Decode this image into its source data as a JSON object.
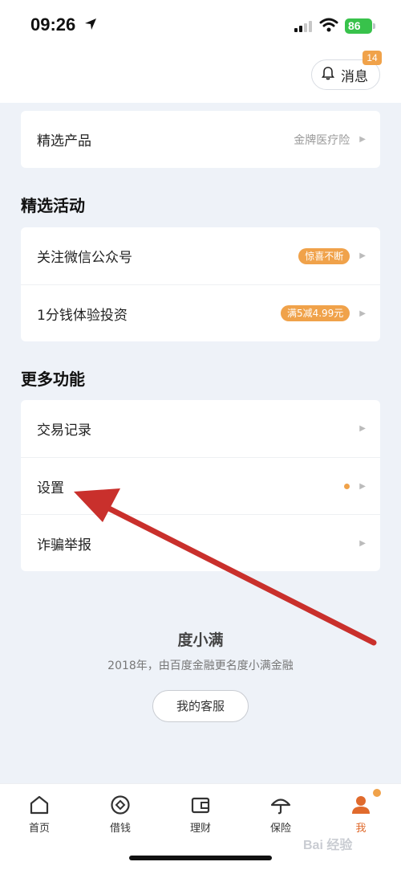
{
  "status_bar": {
    "time": "09:26",
    "battery": "86"
  },
  "header": {
    "message_label": "消息",
    "message_count": "14"
  },
  "featured_card": {
    "label": "精选产品",
    "value": "金牌医疗险"
  },
  "activities": {
    "title": "精选活动",
    "items": [
      {
        "label": "关注微信公众号",
        "tag": "惊喜不断"
      },
      {
        "label": "1分钱体验投资",
        "tag": "满5减4.99元"
      }
    ]
  },
  "more": {
    "title": "更多功能",
    "items": [
      {
        "label": "交易记录"
      },
      {
        "label": "设置"
      },
      {
        "label": "诈骗举报"
      }
    ]
  },
  "footer": {
    "brand": "度小满",
    "description": "2018年，由百度金融更名度小满金融",
    "service_button": "我的客服"
  },
  "tabbar": {
    "items": [
      {
        "label": "首页",
        "icon": "home-icon"
      },
      {
        "label": "借钱",
        "icon": "loan-icon"
      },
      {
        "label": "理财",
        "icon": "wallet-icon"
      },
      {
        "label": "保险",
        "icon": "umbrella-icon"
      },
      {
        "label": "我",
        "icon": "user-icon"
      }
    ]
  },
  "watermark": "Bai 经验",
  "colors": {
    "accent": "#f0a24a",
    "active_tab": "#e06a2c",
    "annotation_arrow": "#c9302c",
    "background": "#eef2f8"
  }
}
